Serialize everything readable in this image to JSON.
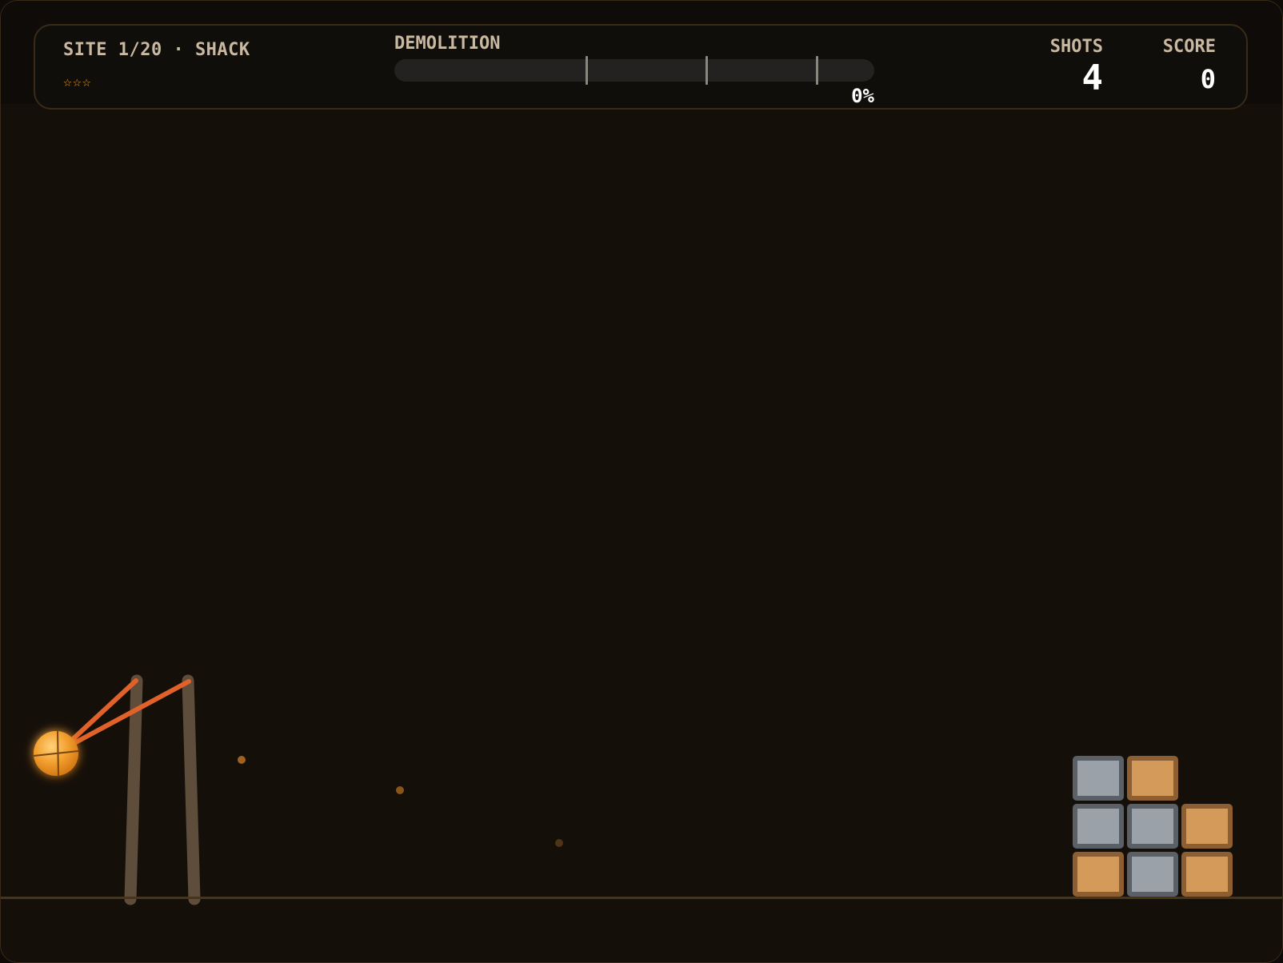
{
  "hud": {
    "site_label": "SITE 1/20 · SHACK",
    "stars": [
      "☆",
      "☆",
      "☆"
    ],
    "demolition_label": "DEMOLITION",
    "demolition_percent_text": "0%",
    "demolition_progress": 0,
    "demolition_thresholds": [
      0.4,
      0.65,
      0.88
    ],
    "shots_label": "SHOTS",
    "shots_value": "4",
    "score_label": "SCORE",
    "score_value": "0"
  },
  "colors": {
    "background": "#150f0a",
    "accent": "#e89a2a",
    "band": "#e0622a",
    "slingshot": "#5e4d3a",
    "stone": "#9aa1a8",
    "wood": "#d49a5a",
    "trajectory_dot": "#a0621e"
  },
  "icons": {
    "projectile": "wrecking-ball-icon",
    "launcher": "slingshot-icon"
  },
  "structure": {
    "name": "shack",
    "columns": 3,
    "rows": 3,
    "cells": [
      {
        "row": 0,
        "col": 0,
        "material": "wood"
      },
      {
        "row": 0,
        "col": 1,
        "material": "stone"
      },
      {
        "row": 0,
        "col": 2,
        "material": "wood"
      },
      {
        "row": 1,
        "col": 0,
        "material": "stone"
      },
      {
        "row": 1,
        "col": 1,
        "material": "stone"
      },
      {
        "row": 1,
        "col": 2,
        "material": "wood"
      },
      {
        "row": 2,
        "col": 0,
        "material": "stone"
      },
      {
        "row": 2,
        "col": 1,
        "material": "wood"
      }
    ]
  }
}
